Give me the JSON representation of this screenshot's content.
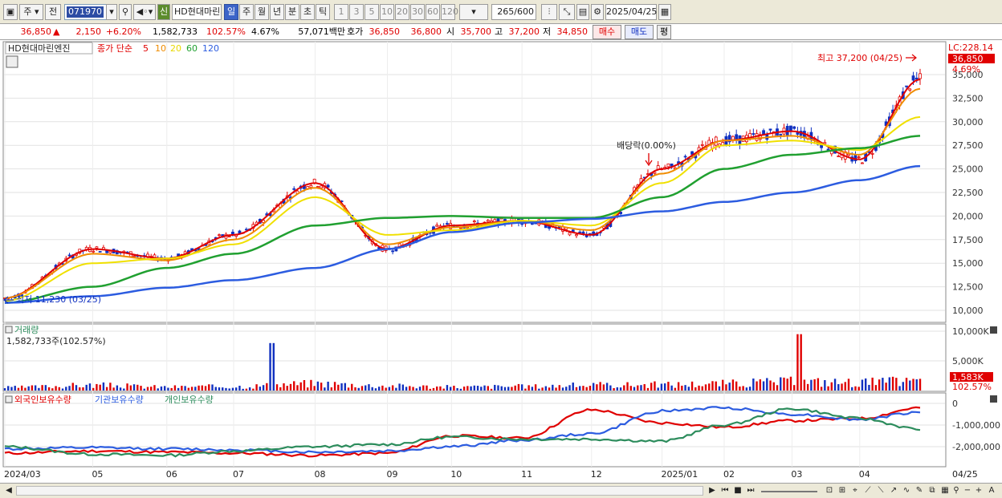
{
  "toolbar": {
    "market": "주",
    "prev_label": "전",
    "code": "071970",
    "new_badge": "신",
    "stock_name": "HD현대마린",
    "periods": [
      {
        "label": "일",
        "selected": true
      },
      {
        "label": "주"
      },
      {
        "label": "월"
      },
      {
        "label": "년"
      },
      {
        "label": "분"
      },
      {
        "label": "초"
      },
      {
        "label": "틱"
      }
    ],
    "intervals": [
      "1",
      "3",
      "5",
      "10",
      "20",
      "30",
      "60",
      "120"
    ],
    "count": "265",
    "count_max": "/600",
    "date": "2025/04/25"
  },
  "quote": {
    "price": "36,850",
    "arrow": "▲",
    "change": "2,150",
    "change_pct": "+6.20%",
    "volume": "1,582,733",
    "volume_ratio": "102.57%",
    "turnover": "4.67%",
    "amount": "57,071백만",
    "ask_label": "호가",
    "ask": "36,850",
    "bid": "36,800",
    "open_label": "시",
    "open": "35,700",
    "high_label": "고",
    "high": "37,200",
    "low_label": "저",
    "low": "34,850",
    "buy_label": "매수",
    "sell_label": "매도",
    "eval_label": "평"
  },
  "price_panel": {
    "legend_name": "HD현대마린엔진",
    "ma_prefix": "종가 단순",
    "ma_labels": [
      "5",
      "10",
      "20",
      "60",
      "120"
    ],
    "lc_label": "LC:228.14",
    "current_price_tag": "36,850",
    "current_pct": "4.69%",
    "high_annotation": "최고 37,200 (04/25)",
    "low_annotation": "최저 11,230 (03/25)",
    "dividend_annotation": "배당락(0.00%)",
    "y_ticks": [
      "35,000",
      "32,500",
      "30,000",
      "27,500",
      "25,000",
      "22,500",
      "20,000",
      "17,500",
      "15,000",
      "12,500",
      "10,000"
    ]
  },
  "volume_panel": {
    "title": "거래량",
    "value_text": "1,582,733주(102.57%)",
    "y_ticks": [
      "10,000K",
      "5,000K"
    ],
    "current_tag": "1,583K",
    "current_pct": "102.57%"
  },
  "holdings_panel": {
    "legend": [
      "외국인보유수량",
      "기관보유수량",
      "개인보유수량"
    ],
    "y_ticks": [
      "0",
      "-1,000,000",
      "-2,000,000"
    ]
  },
  "x_axis": {
    "labels": [
      "2024/03",
      "05",
      "06",
      "07",
      "08",
      "09",
      "10",
      "11",
      "12",
      "2025/01",
      "02",
      "03",
      "04"
    ],
    "right_label": "04/25"
  },
  "colors": {
    "ma5": "#e00000",
    "ma10": "#f08c00",
    "ma20": "#f0e000",
    "ma60": "#20a030",
    "ma120": "#2c5ce0",
    "up": "#e00000",
    "down": "#1030c0",
    "foreign": "#e00000",
    "institution": "#2c5ce0",
    "individual": "#2c8c5c"
  },
  "chart_data": [
    {
      "type": "line",
      "title": "HD현대마린엔진",
      "x": [
        "2024/03",
        "05",
        "06",
        "07",
        "08",
        "09",
        "10",
        "11",
        "12",
        "2025/01",
        "02",
        "03",
        "04",
        "04/25"
      ],
      "series": [
        {
          "name": "5",
          "values": [
            11300,
            16500,
            15500,
            18000,
            23500,
            16500,
            19000,
            19500,
            18000,
            25000,
            28000,
            29000,
            26000,
            34500
          ]
        },
        {
          "name": "10",
          "values": [
            11300,
            16000,
            15300,
            17500,
            23000,
            17000,
            18800,
            19500,
            18500,
            24500,
            28000,
            28500,
            26500,
            33500
          ]
        },
        {
          "name": "20",
          "values": [
            11000,
            15000,
            15500,
            17000,
            22000,
            18000,
            18500,
            19500,
            19000,
            23500,
            27500,
            28000,
            27000,
            30500
          ]
        },
        {
          "name": "60",
          "values": [
            10800,
            12500,
            14500,
            16000,
            19000,
            19800,
            20000,
            19800,
            19800,
            22000,
            25000,
            26500,
            27200,
            28500
          ]
        },
        {
          "name": "120",
          "values": [
            10800,
            11500,
            12400,
            13200,
            14500,
            16500,
            18300,
            19300,
            19700,
            20500,
            21500,
            22500,
            23800,
            25300
          ]
        }
      ],
      "ylim": [
        10000,
        37500
      ],
      "high": 37200,
      "low": 11230,
      "last": 36850
    },
    {
      "type": "bar",
      "title": "거래량",
      "x": [
        "2024/03",
        "05",
        "06",
        "07",
        "08",
        "09",
        "10",
        "11",
        "12",
        "2025/01",
        "02",
        "03",
        "04",
        "04/25"
      ],
      "values": [
        500,
        900,
        600,
        700,
        1200,
        800,
        600,
        700,
        900,
        1000,
        1200,
        1500,
        1400,
        1583
      ],
      "peaks": [
        {
          "label": "08",
          "value": 8000
        },
        {
          "label": "03",
          "value": 9500
        }
      ],
      "ylim": [
        0,
        10000
      ]
    },
    {
      "type": "line",
      "legend": [
        "외국인보유수량",
        "기관보유수량",
        "개인보유수량"
      ],
      "x": [
        "2024/03",
        "05",
        "06",
        "07",
        "08",
        "09",
        "10",
        "11",
        "12",
        "2025/01",
        "02",
        "03",
        "04",
        "04/25"
      ],
      "series": [
        {
          "name": "외국인보유수량",
          "values": [
            -2300000,
            -2200000,
            -2250000,
            -2300000,
            -2400000,
            -2300000,
            -1500000,
            -1600000,
            -300000,
            -900000,
            -1100000,
            -800000,
            -700000,
            -200000
          ]
        },
        {
          "name": "기관보유수량",
          "values": [
            -2100000,
            -2050000,
            -2100000,
            -2150000,
            -2250000,
            -2200000,
            -2000000,
            -1700000,
            -1400000,
            -350000,
            -200000,
            -500000,
            -750000,
            -400000
          ]
        },
        {
          "name": "개인보유수량",
          "values": [
            -2000000,
            -2350000,
            -2400000,
            -2200000,
            -2000000,
            -1900000,
            -1550000,
            -1650000,
            -1650000,
            -1750000,
            -1000000,
            -250000,
            -700000,
            -1200000
          ]
        }
      ],
      "ylim": [
        -2500000,
        200000
      ]
    }
  ]
}
